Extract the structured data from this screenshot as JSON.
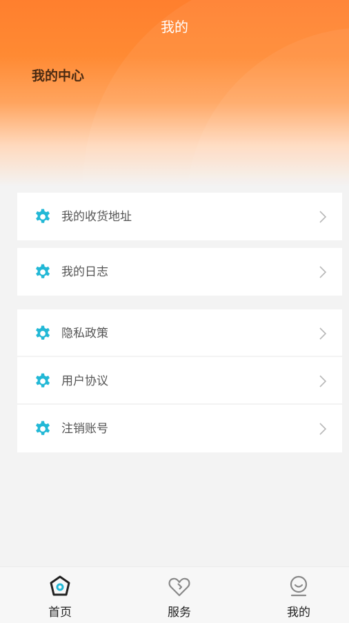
{
  "header": {
    "title": "我的",
    "center_title": "我的中心"
  },
  "menu_groups": [
    {
      "items": [
        {
          "label": "我的收货地址",
          "icon": "gear-icon"
        }
      ]
    },
    {
      "items": [
        {
          "label": "我的日志",
          "icon": "gear-icon"
        }
      ]
    },
    {
      "items": [
        {
          "label": "隐私政策",
          "icon": "gear-icon"
        },
        {
          "label": "用户协议",
          "icon": "gear-icon"
        },
        {
          "label": "注销账号",
          "icon": "gear-icon"
        }
      ]
    }
  ],
  "tabbar": {
    "items": [
      {
        "label": "首页",
        "icon": "home-icon"
      },
      {
        "label": "服务",
        "icon": "heart-icon"
      },
      {
        "label": "我的",
        "icon": "profile-icon"
      }
    ]
  },
  "colors": {
    "accent": "#ff7f2e",
    "icon_teal": "#22b8d6",
    "background": "#f3f3f3"
  }
}
